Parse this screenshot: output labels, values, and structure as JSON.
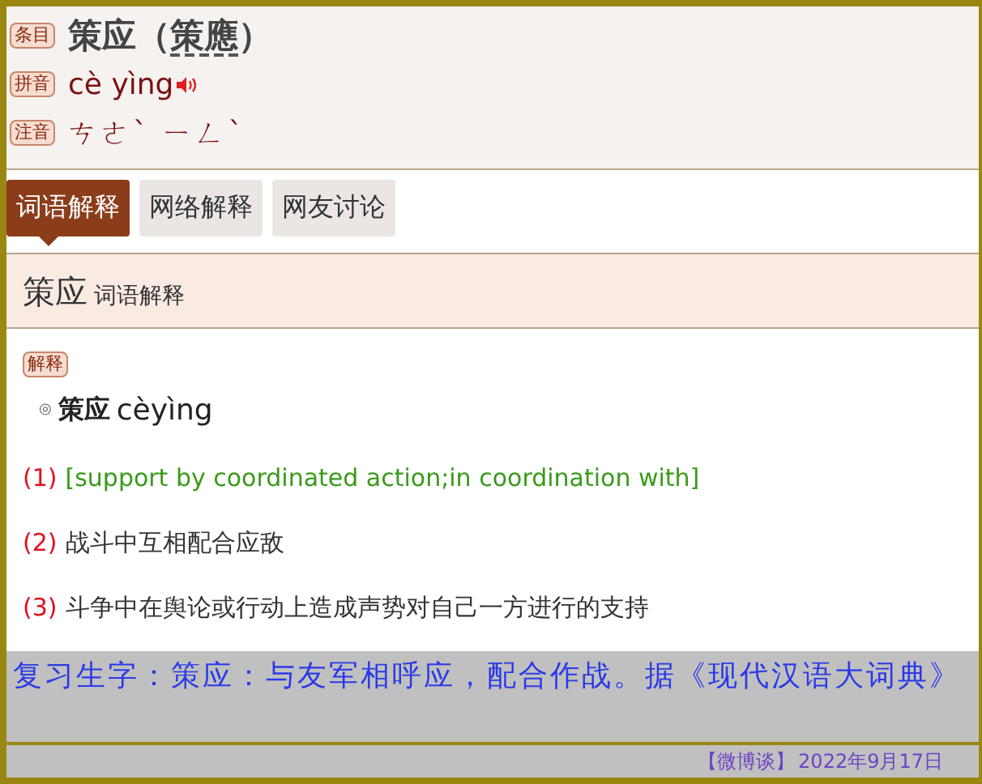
{
  "entry": {
    "headword_label": "条目",
    "headword": "策应",
    "variant_open": "（",
    "variant": "策應",
    "variant_close": "）",
    "pinyin_label": "拼音",
    "pinyin": "cè yìng",
    "zhuyin_label": "注音",
    "zhuyin": "ㄘㄜˋ ㄧㄥˋ"
  },
  "tabs": [
    {
      "label": "词语解释",
      "selected": true
    },
    {
      "label": "网络解释",
      "selected": false
    },
    {
      "label": "网友讨论",
      "selected": false
    }
  ],
  "section": {
    "title": "策应",
    "subtitle": "词语解释"
  },
  "definition": {
    "badge": "解释",
    "bullet": "◎",
    "word": "策应",
    "pinyin": "cèyìng",
    "senses": [
      {
        "number": "(1)",
        "text": "[support by coordinated action;in coordination with]",
        "kind": "english"
      },
      {
        "number": "(2)",
        "text": "战斗中互相配合应敌",
        "kind": "chinese"
      },
      {
        "number": "(3)",
        "text": "斗争中在舆论或行动上造成声势对自己一方进行的支持",
        "kind": "chinese"
      }
    ]
  },
  "note": "复习生字：策应：与友军相呼应，配合作战。据《现代汉语大词典》",
  "footer": {
    "source": "【微博谈】",
    "date": "2022年9月17日"
  }
}
